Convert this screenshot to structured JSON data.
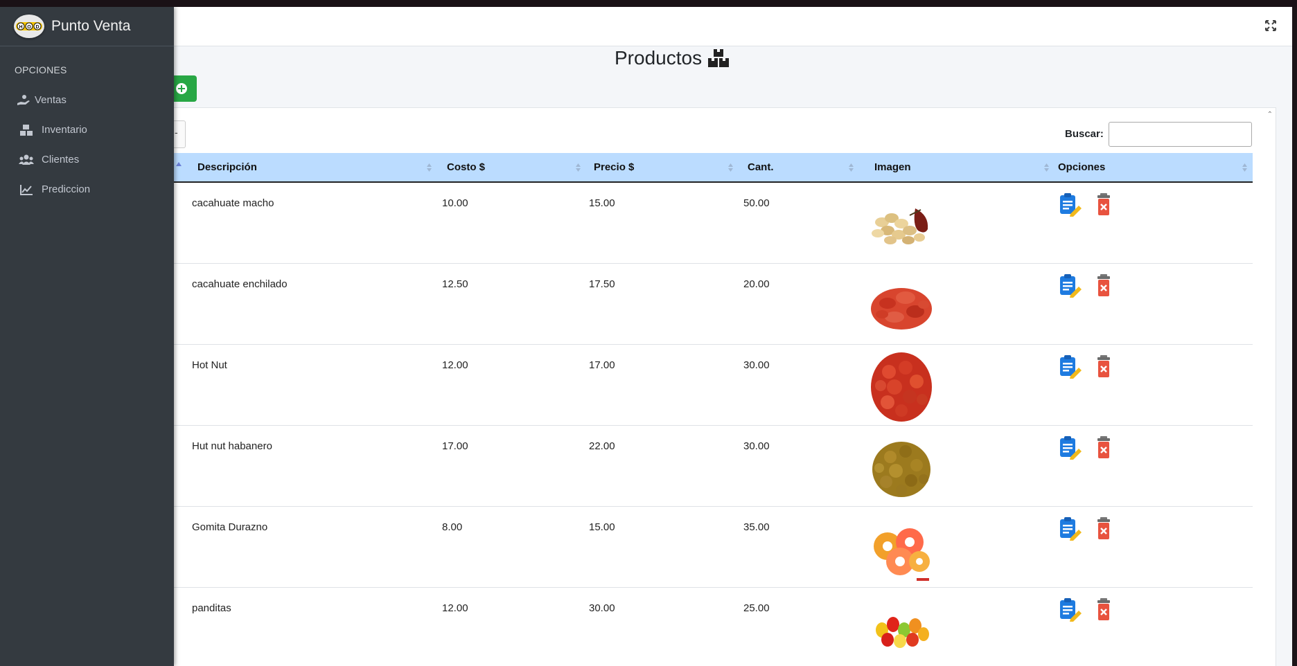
{
  "brand": {
    "name": "Punto Venta",
    "logo_text": "HOD"
  },
  "sidebar": {
    "header": "OPCIONES",
    "items": [
      {
        "label": "Ventas",
        "icon": "hand-money-icon"
      },
      {
        "label": "Inventario",
        "icon": "boxes-icon"
      },
      {
        "label": "Clientes",
        "icon": "users-icon"
      },
      {
        "label": "Prediccion",
        "icon": "chart-line-icon"
      }
    ]
  },
  "page": {
    "title": "Productos",
    "title_icon": "boxes-icon"
  },
  "toolbar": {
    "add_icon": "plus-circle-icon",
    "length_partial": "-"
  },
  "search": {
    "label": "Buscar:",
    "value": ""
  },
  "table": {
    "columns": [
      "Descripción",
      "Costo $",
      "Precio $",
      "Cant.",
      "Imagen",
      "Opciones"
    ],
    "rows": [
      {
        "descripcion": "cacahuate macho",
        "costo": "10.00",
        "precio": "15.00",
        "cant": "50.00",
        "image": "peanuts"
      },
      {
        "descripcion": "cacahuate enchilado",
        "costo": "12.50",
        "precio": "17.50",
        "cant": "20.00",
        "image": "chili-peanuts"
      },
      {
        "descripcion": "Hot Nut",
        "costo": "12.00",
        "precio": "17.00",
        "cant": "30.00",
        "image": "hot-nut"
      },
      {
        "descripcion": "Hut nut habanero",
        "costo": "17.00",
        "precio": "22.00",
        "cant": "30.00",
        "image": "habanero-nut"
      },
      {
        "descripcion": "Gomita Durazno",
        "costo": "8.00",
        "precio": "15.00",
        "cant": "35.00",
        "image": "peach-gummies"
      },
      {
        "descripcion": "panditas",
        "costo": "12.00",
        "precio": "30.00",
        "cant": "25.00",
        "image": "gummy-bears"
      }
    ]
  },
  "colors": {
    "sidebar": "#343a40",
    "header_row": "#bbdcff",
    "add_button": "#28a745",
    "edit_icon": "#1e7be0",
    "delete_icon": "#e8533f"
  }
}
